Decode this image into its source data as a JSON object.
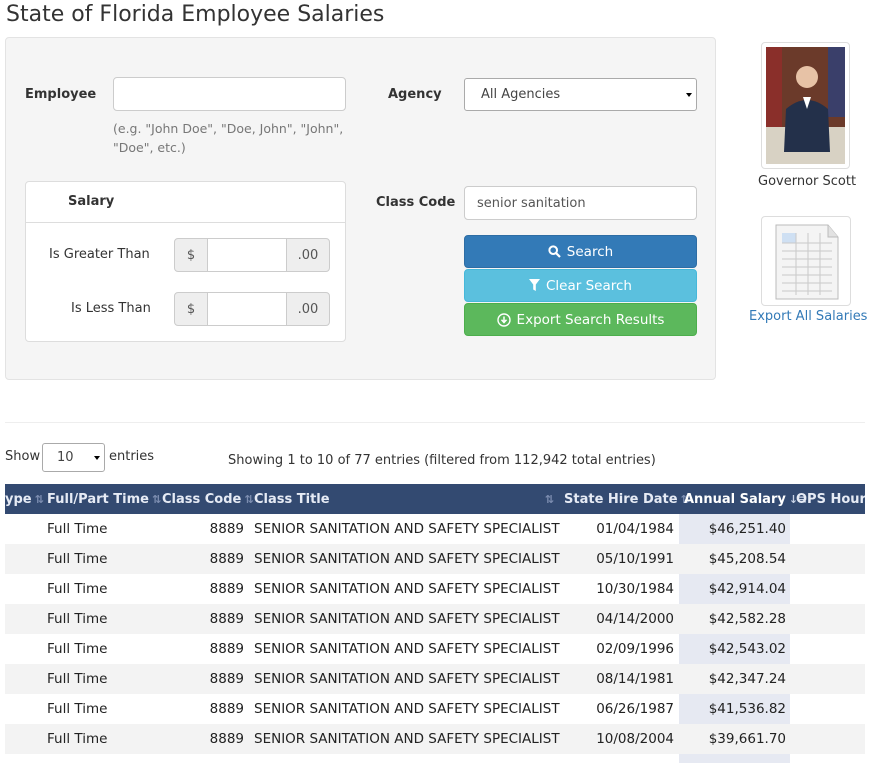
{
  "page": {
    "title": "State of Florida Employee Salaries"
  },
  "search": {
    "employee_label": "Employee",
    "employee_value": "",
    "employee_hint": "(e.g. \"John Doe\", \"Doe, John\", \"John\", \"Doe\", etc.)",
    "agency_label": "Agency",
    "agency_selected": "All Agencies",
    "salary_heading": "Salary",
    "greater_label": "Is Greater Than",
    "less_label": "Is Less Than",
    "currency_symbol": "$",
    "cents_suffix": ".00",
    "class_code_label": "Class Code",
    "class_code_value": "senior sanitation",
    "search_button": "Search",
    "clear_button": "Clear Search",
    "export_button": "Export Search Results"
  },
  "sidebar": {
    "governor_caption": "Governor Scott",
    "export_all_link": "Export All Salaries"
  },
  "table_controls": {
    "show_label": "Show",
    "page_length": "10",
    "entries_label": "entries",
    "info": "Showing 1 to 10 of 77 entries (filtered from 112,942 total entries)"
  },
  "table": {
    "headers": [
      "ype",
      "Full/Part Time",
      "Class Code",
      "Class Title",
      "State Hire Date",
      "Annual Salary",
      "OPS Hourl"
    ],
    "rows": [
      {
        "type": "Full Time",
        "code": "8889",
        "title": "SENIOR SANITATION AND SAFETY SPECIALIST",
        "hire": "01/04/1984",
        "salary": "$46,251.40"
      },
      {
        "type": "Full Time",
        "code": "8889",
        "title": "SENIOR SANITATION AND SAFETY SPECIALIST",
        "hire": "05/10/1991",
        "salary": "$45,208.54"
      },
      {
        "type": "Full Time",
        "code": "8889",
        "title": "SENIOR SANITATION AND SAFETY SPECIALIST",
        "hire": "10/30/1984",
        "salary": "$42,914.04"
      },
      {
        "type": "Full Time",
        "code": "8889",
        "title": "SENIOR SANITATION AND SAFETY SPECIALIST",
        "hire": "04/14/2000",
        "salary": "$42,582.28"
      },
      {
        "type": "Full Time",
        "code": "8889",
        "title": "SENIOR SANITATION AND SAFETY SPECIALIST",
        "hire": "02/09/1996",
        "salary": "$42,543.02"
      },
      {
        "type": "Full Time",
        "code": "8889",
        "title": "SENIOR SANITATION AND SAFETY SPECIALIST",
        "hire": "08/14/1981",
        "salary": "$42,347.24"
      },
      {
        "type": "Full Time",
        "code": "8889",
        "title": "SENIOR SANITATION AND SAFETY SPECIALIST",
        "hire": "06/26/1987",
        "salary": "$41,536.82"
      },
      {
        "type": "Full Time",
        "code": "8889",
        "title": "SENIOR SANITATION AND SAFETY SPECIALIST",
        "hire": "10/08/2004",
        "salary": "$39,661.70"
      }
    ]
  },
  "colors": {
    "header_bg": "#334a71",
    "search": "#337ab7",
    "clear": "#5bc0de",
    "export": "#5cb85c",
    "link": "#337ab7"
  }
}
